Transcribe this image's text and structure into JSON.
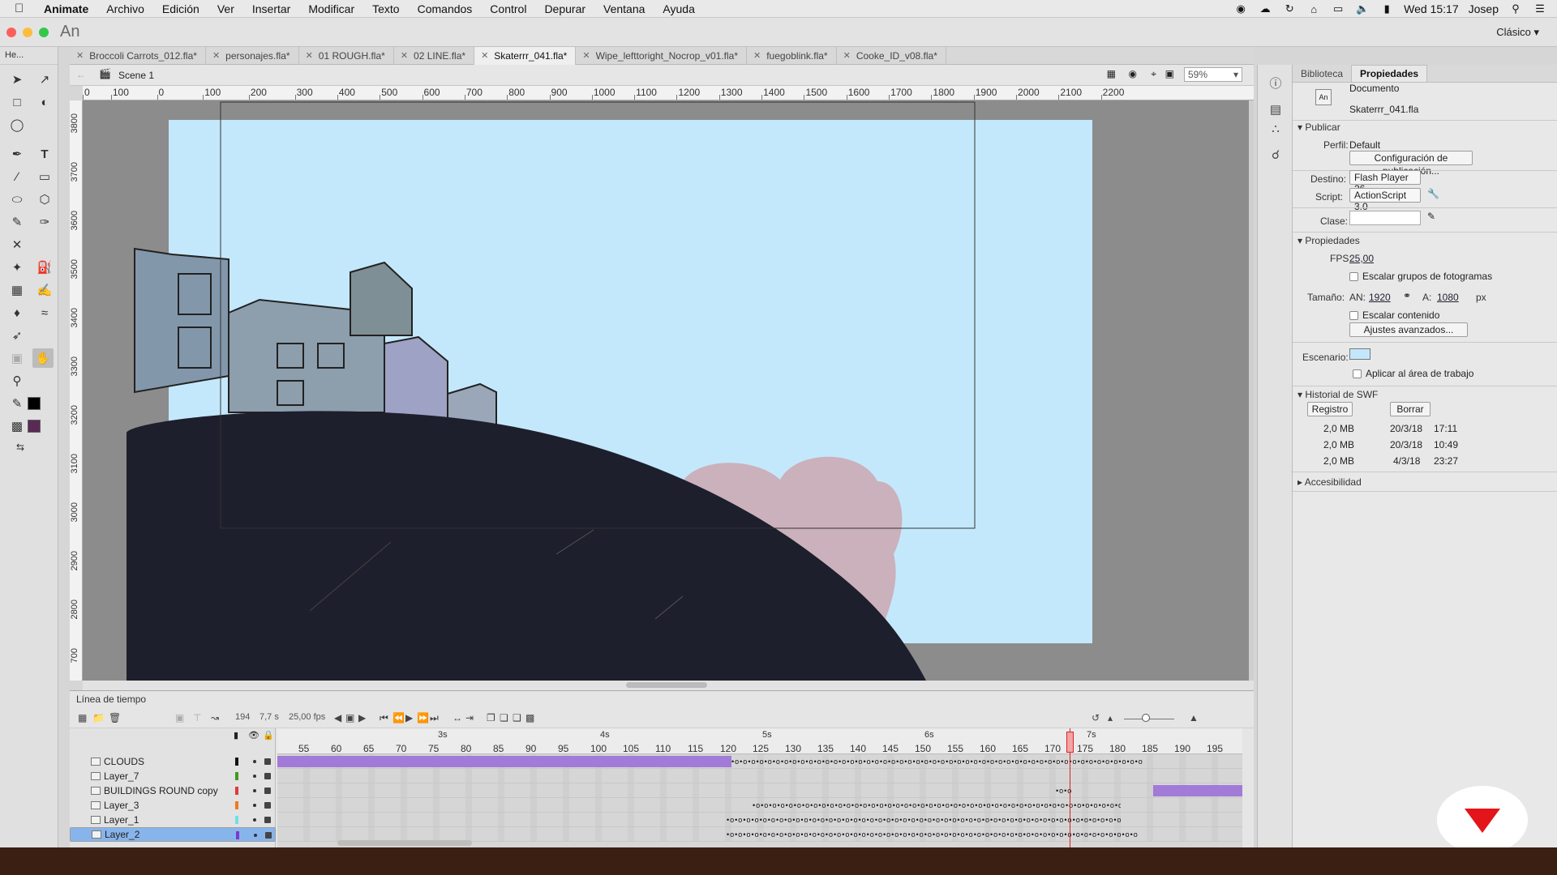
{
  "menubar": {
    "app": "Animate",
    "items": [
      "Archivo",
      "Edición",
      "Ver",
      "Insertar",
      "Modificar",
      "Texto",
      "Comandos",
      "Control",
      "Depurar",
      "Ventana",
      "Ayuda"
    ],
    "clock": "Wed 15:17",
    "user": "Josep"
  },
  "window": {
    "app_badge": "An",
    "workspace": "Clásico ▾"
  },
  "toolbar": {
    "header": "He..."
  },
  "tabs": [
    {
      "label": "Broccoli Carrots_012.fla*"
    },
    {
      "label": "personajes.fla*"
    },
    {
      "label": "01 ROUGH.fla*"
    },
    {
      "label": "02 LINE.fla*"
    },
    {
      "label": "Skaterrr_041.fla*",
      "active": true
    },
    {
      "label": "Wipe_lefttoright_Nocrop_v01.fla*"
    },
    {
      "label": "fuegoblink.fla*"
    },
    {
      "label": "Cooke_ID_v08.fla*"
    }
  ],
  "editbar": {
    "scene": "Scene 1",
    "zoom": "59%"
  },
  "ruler": {
    "h_labels": [
      "0",
      "100",
      "0",
      "100",
      "200",
      "300",
      "400",
      "500",
      "600",
      "700",
      "800",
      "900",
      "1000",
      "1100",
      "1200",
      "1300",
      "1400",
      "1500",
      "1600",
      "1700",
      "1800",
      "1900",
      "2000",
      "2100",
      "2200"
    ],
    "v_labels": [
      "3800",
      "3700",
      "3600",
      "3500",
      "3400",
      "3300",
      "3200",
      "3100",
      "3000",
      "2900",
      "2800",
      "700"
    ]
  },
  "props": {
    "tabs": [
      "Biblioteca",
      "Propiedades"
    ],
    "doc_title": "Documento",
    "doc_name": "Skaterrr_041.fla",
    "publish": {
      "section": "Publicar",
      "profile_label": "Perfil:",
      "profile": "Default",
      "config_btn": "Configuración de publicación...",
      "target_label": "Destino:",
      "target": "Flash Player 26",
      "script_label": "Script:",
      "script": "ActionScript 3.0",
      "class_label": "Clase:"
    },
    "properties": {
      "section": "Propiedades",
      "fps_label": "FPS:",
      "fps": "25,00",
      "scale_frames": "Escalar grupos de fotogramas",
      "size_label": "Tamaño:",
      "w_label": "AN:",
      "width": "1920",
      "h_label": "A:",
      "height": "1080",
      "unit": "px",
      "scale_content": "Escalar contenido",
      "advanced_btn": "Ajustes avanzados...",
      "stage_label": "Escenario:",
      "stage_color": "#c4e8fb",
      "apply_work_area": "Aplicar al área de trabajo"
    },
    "swf_history": {
      "section": "Historial de SWF",
      "log_btn": "Registro",
      "clear_btn": "Borrar",
      "rows": [
        {
          "size": "2,0 MB",
          "date": "20/3/18",
          "time": "17:11"
        },
        {
          "size": "2,0 MB",
          "date": "20/3/18",
          "time": "10:49"
        },
        {
          "size": "2,0 MB",
          "date": "4/3/18",
          "time": "23:27"
        }
      ]
    },
    "accessibility": "Accesibilidad"
  },
  "timeline": {
    "title": "Línea de tiempo",
    "current_frame": "194",
    "elapsed": "7,7 s",
    "fps": "25,00 fps",
    "seconds": [
      "3s",
      "4s",
      "5s",
      "6s",
      "7s"
    ],
    "frame_labels": [
      "55",
      "60",
      "65",
      "70",
      "75",
      "80",
      "85",
      "90",
      "95",
      "100",
      "105",
      "110",
      "115",
      "120",
      "125",
      "130",
      "135",
      "140",
      "145",
      "150",
      "155",
      "160",
      "165",
      "170",
      "175",
      "180",
      "185",
      "190",
      "195"
    ],
    "layers": [
      {
        "name": "CLOUDS",
        "color": "#111111"
      },
      {
        "name": "Layer_7",
        "color": "#3f9a22"
      },
      {
        "name": "BUILDINGS ROUND copy",
        "color": "#e23a3a"
      },
      {
        "name": "Layer_3",
        "color": "#f07a1a"
      },
      {
        "name": "Layer_1",
        "color": "#6fe0ea"
      },
      {
        "name": "Layer_2",
        "color": "#7a3ad0",
        "selected": true
      }
    ]
  }
}
